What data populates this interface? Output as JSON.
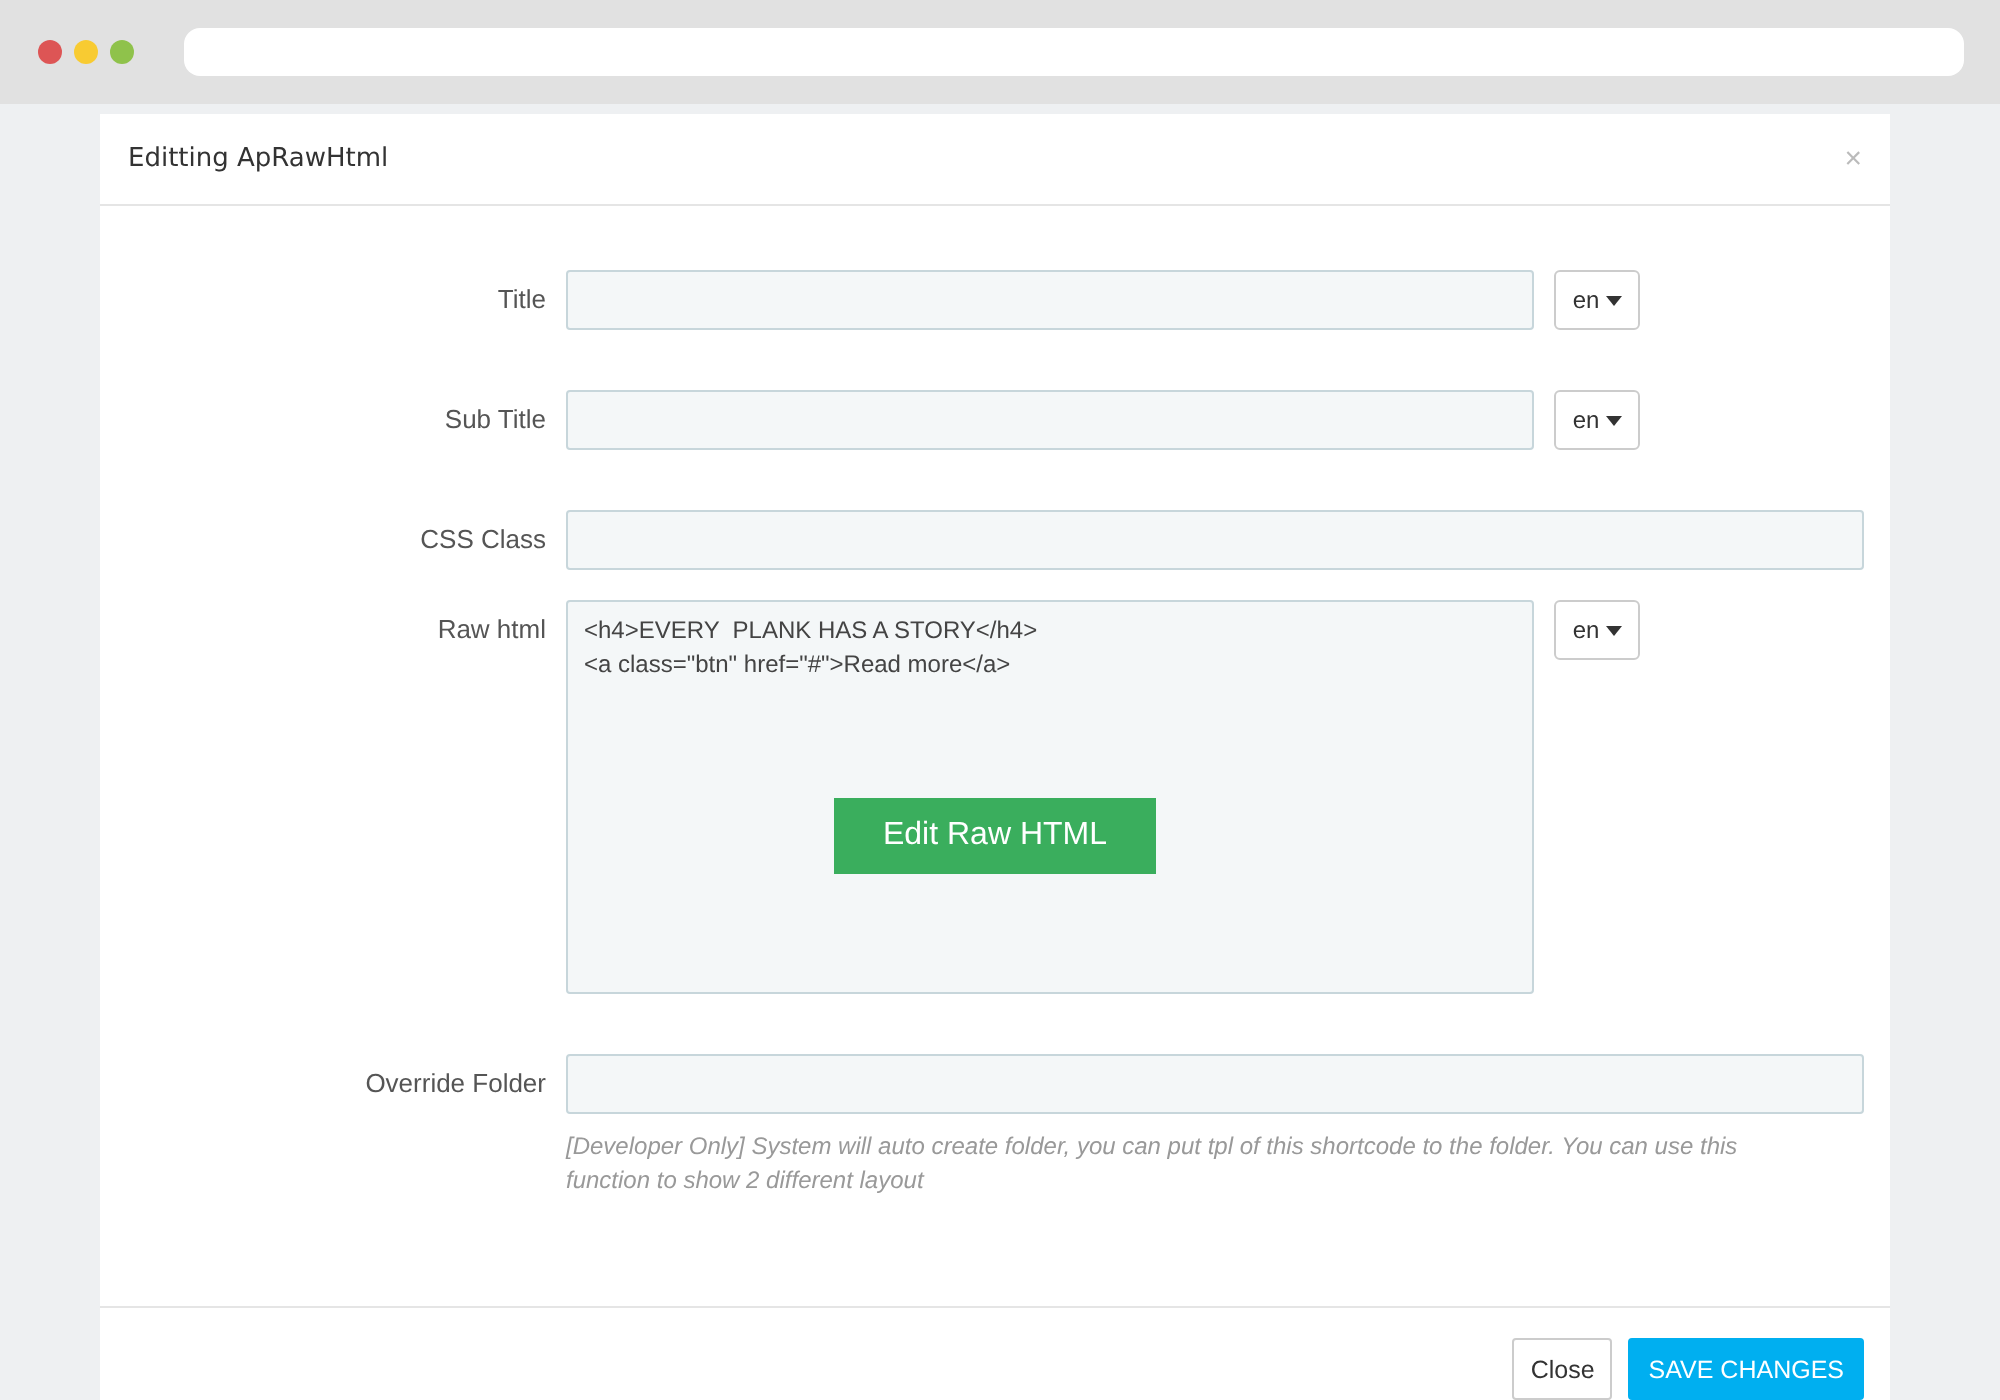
{
  "modal": {
    "title": "Editting ApRawHtml",
    "close": "×"
  },
  "fields": [
    {
      "label": "Title",
      "kind": "input",
      "lang": "en"
    },
    {
      "label": "Sub Title",
      "kind": "input",
      "lang": "en"
    },
    {
      "label": "CSS Class",
      "kind": "input"
    },
    {
      "label": "Raw html",
      "kind": "code",
      "lines": [
        "<h4>EVERY  PLANK HAS A STORY</h4>",
        "<a class=\"btn\" href=\"#\">Read more</a>"
      ],
      "action": "Edit Raw HTML",
      "lang": "en"
    },
    {
      "label": "Override Folder",
      "kind": "input",
      "help": "[Developer Only] System will auto create folder, you can put tpl of this shortcode to the folder. You can use this function to show 2 different layout"
    }
  ],
  "buttons": [
    {
      "label": "Close",
      "kind": "default"
    },
    {
      "label": "SAVE CHANGES",
      "kind": "primary"
    }
  ]
}
